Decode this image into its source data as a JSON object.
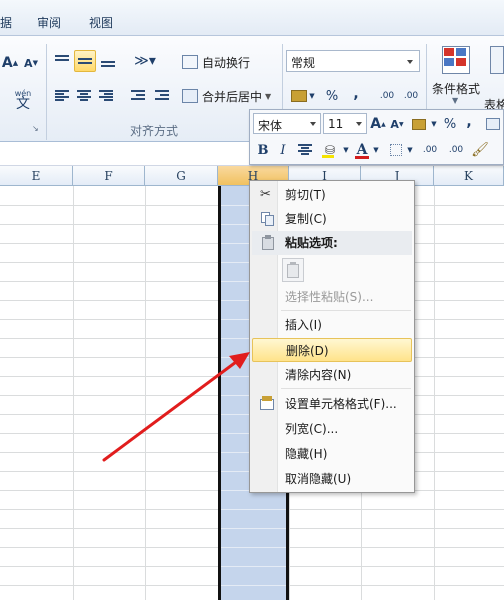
{
  "tabs": [
    "据",
    "审阅",
    "视图"
  ],
  "ribbon": {
    "font_grow": "A",
    "font_shrink": "A",
    "wen_glyph": "wén",
    "wen_char": "文",
    "wrap_text": "自动换行",
    "merge_center": "合并后居中",
    "number_format": "常规",
    "percent": "%",
    "comma": ",",
    "inc_decimal": ".00",
    "dec_decimal": ".00",
    "cond_format": "条件格式",
    "table_format_partial": "表格",
    "alignment_group": "对齐方式"
  },
  "mini_toolbar": {
    "font_name": "宋体",
    "font_size": "11",
    "bold": "B",
    "italic": "I",
    "font_color": "A",
    "percent": "%",
    "comma": ","
  },
  "columns": [
    "E",
    "F",
    "G",
    "H",
    "I",
    "J",
    "K"
  ],
  "selected_column": "H",
  "context_menu": {
    "items": [
      {
        "label": "剪切(T)",
        "icon": "scissors-icon"
      },
      {
        "label": "复制(C)",
        "icon": "copy-icon"
      },
      {
        "label": "粘贴选项:",
        "icon": "paste-icon"
      },
      {
        "label": "",
        "icon": "paste-option-icon"
      },
      {
        "label": "选择性粘贴(S)...",
        "icon": ""
      },
      {
        "label": "插入(I)",
        "icon": ""
      },
      {
        "label": "删除(D)",
        "icon": ""
      },
      {
        "label": "清除内容(N)",
        "icon": ""
      },
      {
        "label": "设置单元格格式(F)...",
        "icon": "format-cells-icon"
      },
      {
        "label": "列宽(C)...",
        "icon": ""
      },
      {
        "label": "隐藏(H)",
        "icon": ""
      },
      {
        "label": "取消隐藏(U)",
        "icon": ""
      }
    ],
    "highlighted": "删除(D)"
  },
  "colors": {
    "selection_fill": "#c5d5ec",
    "menu_highlight": "#ffe38a",
    "arrow": "#e11d1d"
  }
}
